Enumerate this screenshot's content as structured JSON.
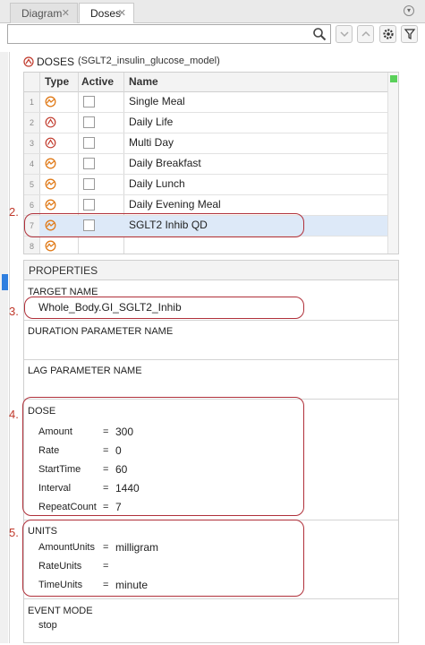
{
  "tabs": [
    {
      "label": "Diagram",
      "active": false
    },
    {
      "label": "Doses",
      "active": true
    }
  ],
  "search": {
    "value": "",
    "placeholder": ""
  },
  "doses": {
    "title": "DOSES",
    "model": "(SGLT2_insulin_glucose_model)",
    "columns": [
      "Type",
      "Active",
      "Name"
    ],
    "rows": [
      {
        "num": "1",
        "name": "Single Meal",
        "type_icon": "repeat-dose-icon"
      },
      {
        "num": "2",
        "name": "Daily Life",
        "type_icon": "schedule-dose-icon"
      },
      {
        "num": "3",
        "name": "Multi Day",
        "type_icon": "schedule-dose-icon"
      },
      {
        "num": "4",
        "name": "Daily Breakfast",
        "type_icon": "repeat-dose-icon"
      },
      {
        "num": "5",
        "name": "Daily Lunch",
        "type_icon": "repeat-dose-icon"
      },
      {
        "num": "6",
        "name": "Daily Evening Meal",
        "type_icon": "repeat-dose-icon"
      },
      {
        "num": "7",
        "name": "SGLT2 Inhib QD",
        "type_icon": "repeat-dose-icon"
      },
      {
        "num": "8",
        "name": "",
        "type_icon": "repeat-dose-icon"
      }
    ]
  },
  "properties": {
    "header": "PROPERTIES",
    "target_name_label": "TARGET NAME",
    "target_name_value": "Whole_Body.GI_SGLT2_Inhib",
    "duration_label": "DURATION PARAMETER NAME",
    "lag_label": "LAG PARAMETER NAME",
    "dose_label": "DOSE",
    "dose": [
      {
        "key": "Amount",
        "value": "300"
      },
      {
        "key": "Rate",
        "value": "0"
      },
      {
        "key": "StartTime",
        "value": "60"
      },
      {
        "key": "Interval",
        "value": "1440"
      },
      {
        "key": "RepeatCount",
        "value": "7"
      }
    ],
    "units_label": "UNITS",
    "units": [
      {
        "key": "AmountUnits",
        "value": "milligram"
      },
      {
        "key": "RateUnits",
        "value": ""
      },
      {
        "key": "TimeUnits",
        "value": "minute"
      }
    ],
    "event_mode_label": "EVENT MODE",
    "event_mode_value": "stop"
  },
  "annotations": [
    "2.",
    "3.",
    "4.",
    "5."
  ],
  "colors": {
    "accent": "#2f7fe0",
    "annotation": "#c0392b",
    "dose_icon": "#e07b1a",
    "schedule_icon": "#c0392b"
  }
}
